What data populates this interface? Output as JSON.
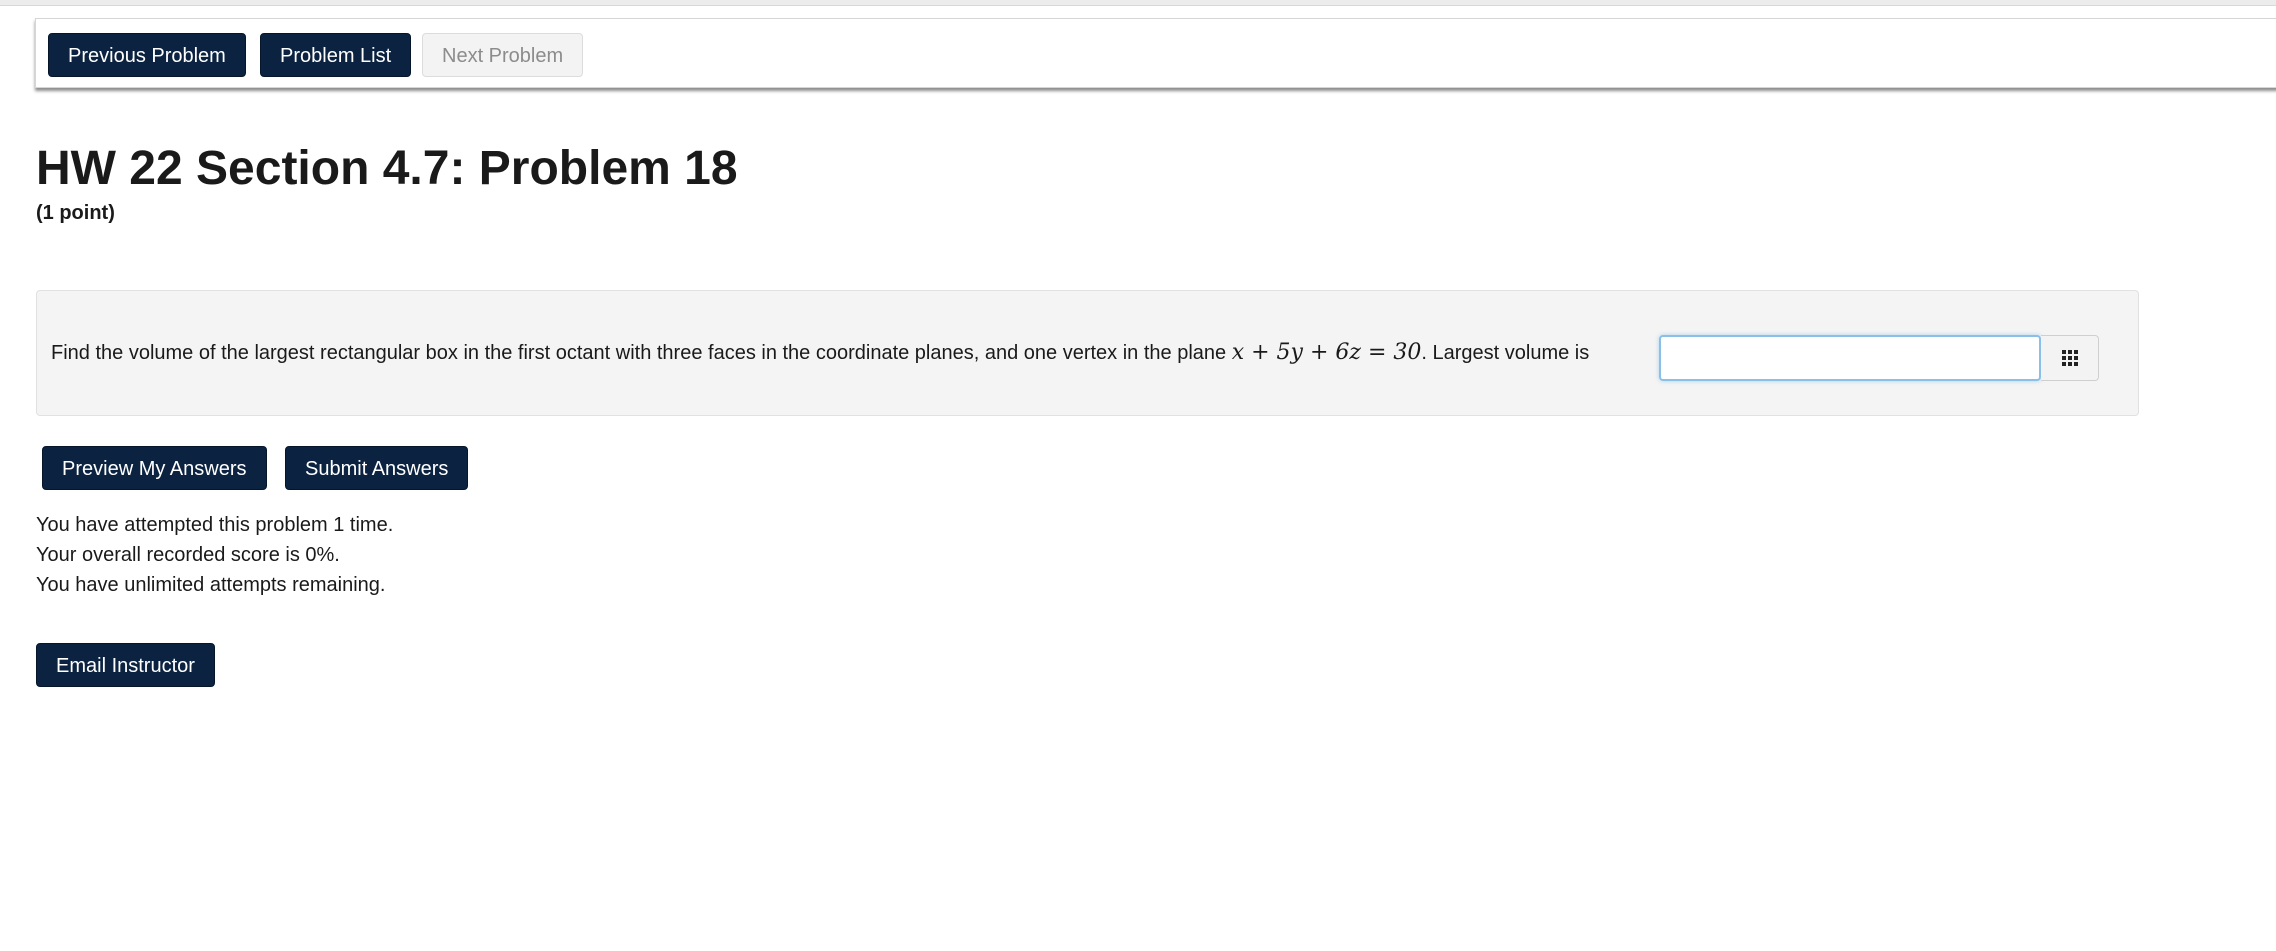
{
  "nav": {
    "previous_label": "Previous Problem",
    "list_label": "Problem List",
    "next_label": "Next Problem"
  },
  "problem": {
    "title": "HW 22 Section 4.7: Problem 18",
    "points": "(1 point)",
    "text_before": "Find the volume of the largest rectangular box in the first octant with three faces in the coordinate planes, and one vertex in the plane ",
    "equation": "x + 5y + 6z = 30",
    "text_after": ". Largest volume is",
    "answer_value": "",
    "answer_tool_icon": "grid-icon"
  },
  "actions": {
    "preview_label": "Preview My Answers",
    "submit_label": "Submit Answers",
    "email_label": "Email Instructor"
  },
  "status": {
    "attempts": "You have attempted this problem 1 time.",
    "score": "Your overall recorded score is 0%.",
    "remaining": "You have unlimited attempts remaining."
  },
  "colors": {
    "button_primary": "#0b2341",
    "problem_background": "#f4f4f4",
    "input_focus_border": "#8ac0e8"
  }
}
